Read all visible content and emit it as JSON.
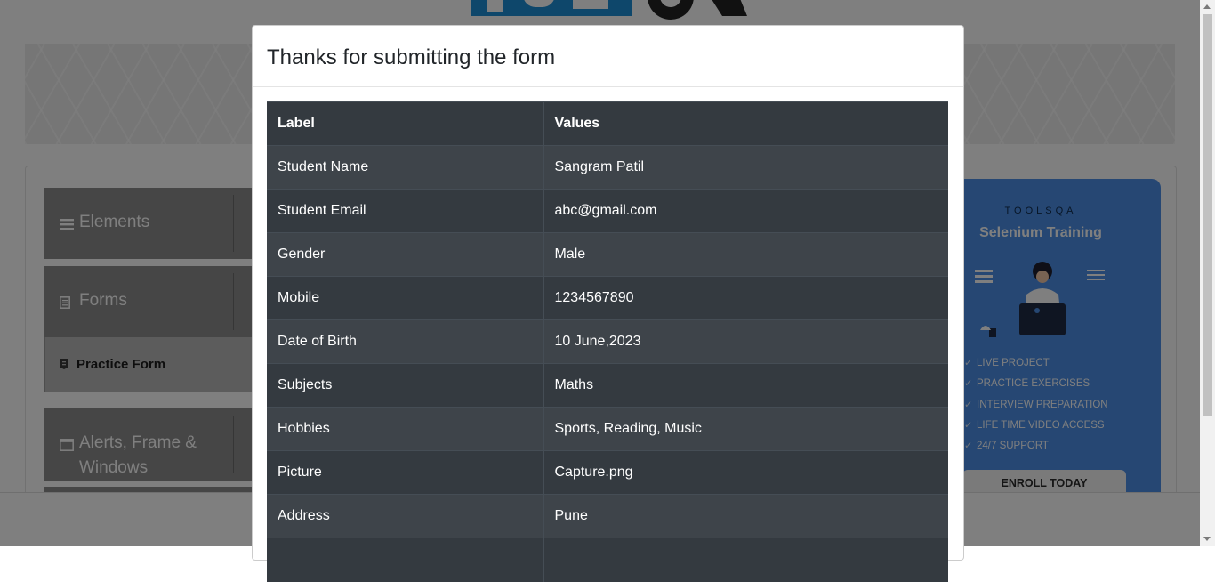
{
  "sidebar": {
    "groups": [
      {
        "title": "Elements",
        "icon": "menu-lines-icon"
      },
      {
        "title": "Forms",
        "icon": "document-icon"
      },
      {
        "title": "Alerts, Frame &",
        "title2": "Windows",
        "icon": "window-icon"
      }
    ],
    "active_item": {
      "label": "Practice Form",
      "icon": "html5-icon"
    }
  },
  "ad": {
    "brand": "TOOLSQA",
    "title": "Selenium Training",
    "features": [
      "LIVE PROJECT",
      "PRACTICE EXERCISES",
      "INTERVIEW PREPARATION",
      "LIFE TIME VIDEO ACCESS",
      "24/7 SUPPORT"
    ],
    "cta": "ENROLL TODAY"
  },
  "modal": {
    "title": "Thanks for submitting the form",
    "columns": [
      "Label",
      "Values"
    ],
    "rows": [
      {
        "label": "Student Name",
        "value": "Sangram Patil"
      },
      {
        "label": "Student Email",
        "value": "abc@gmail.com"
      },
      {
        "label": "Gender",
        "value": "Male"
      },
      {
        "label": "Mobile",
        "value": "1234567890"
      },
      {
        "label": "Date of Birth",
        "value": "10 June,2023"
      },
      {
        "label": "Subjects",
        "value": "Maths"
      },
      {
        "label": "Hobbies",
        "value": "Sports, Reading, Music"
      },
      {
        "label": "Picture",
        "value": "Capture.png"
      },
      {
        "label": "Address",
        "value": "Pune"
      }
    ]
  },
  "colors": {
    "overlay": "rgba(0,0,0,0.5)",
    "table_header": "#343a40",
    "table_stripe": "#3e444a",
    "ad_blue": "#4d8fe6"
  }
}
